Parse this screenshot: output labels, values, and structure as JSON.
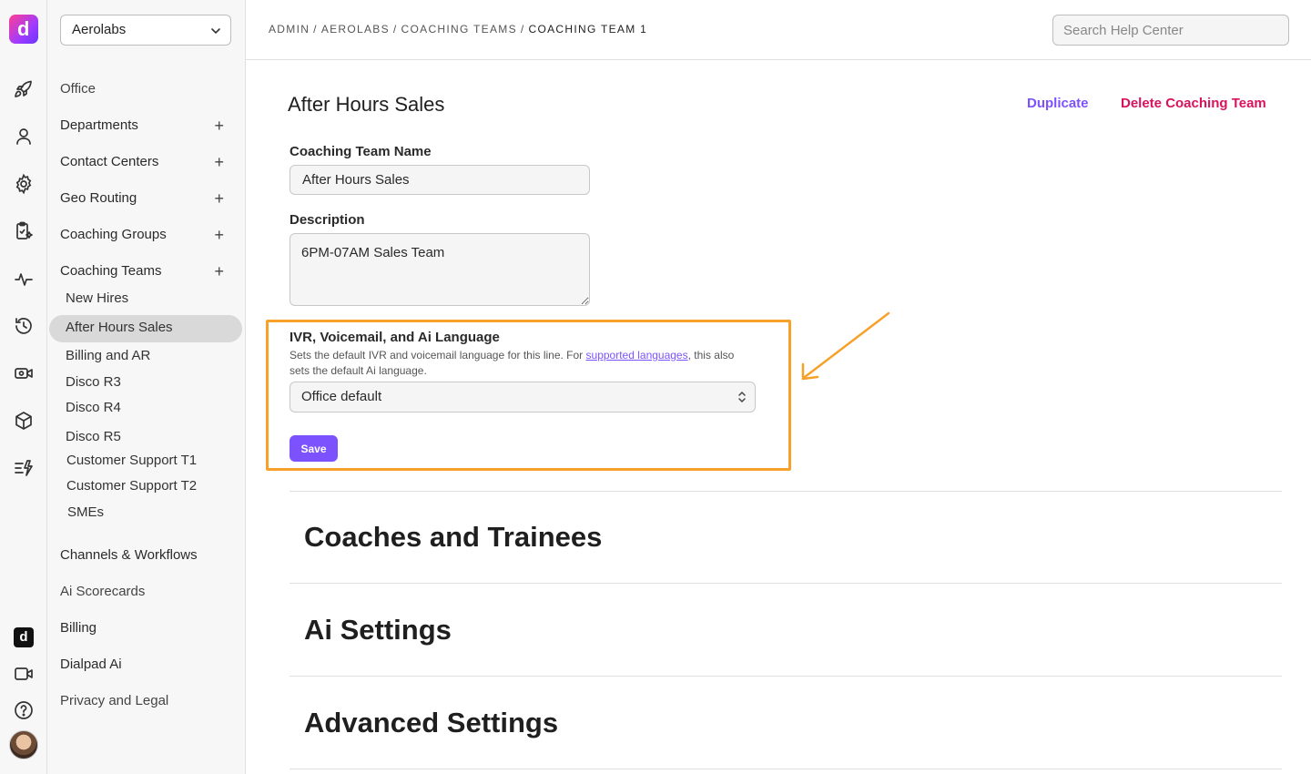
{
  "app": {
    "logo_letter": "d",
    "rail_logo_letter": "d"
  },
  "rail": {
    "icons": [
      "rocket-icon",
      "person-icon",
      "gear-icon",
      "clipboard-sparkle-icon",
      "activity-icon",
      "history-icon",
      "video-gear-icon",
      "cube-icon",
      "workflow-icon",
      "dialpad-app-icon",
      "video-icon",
      "help-icon"
    ]
  },
  "sidebar": {
    "org_selected": "Aerolabs",
    "items": {
      "office": "Office",
      "departments": "Departments",
      "contact_centers": "Contact Centers",
      "geo_routing": "Geo Routing",
      "coaching_groups": "Coaching Groups",
      "coaching_teams": "Coaching Teams",
      "channels_workflows": "Channels & Workflows",
      "ai_scorecards": "Ai Scorecards",
      "billing": "Billing",
      "dialpad_ai": "Dialpad Ai",
      "privacy_legal": "Privacy and Legal"
    },
    "plus_symbol": "+",
    "coaching_teams_children": [
      "New Hires",
      "After Hours Sales",
      "Billing and AR",
      "Disco R3",
      "Disco R4",
      "Disco R5",
      "Customer Support T1",
      "Customer Support T2",
      "SMEs"
    ]
  },
  "topbar": {
    "breadcrumb": [
      "ADMIN",
      "AEROLABS",
      "COACHING TEAMS",
      "COACHING TEAM 1"
    ],
    "separator": "/",
    "search_placeholder": "Search Help Center"
  },
  "main": {
    "title": "After Hours Sales",
    "duplicate_label": "Duplicate",
    "delete_label": "Delete Coaching Team",
    "name_label": "Coaching Team Name",
    "name_value": "After Hours Sales",
    "description_label": "Description",
    "description_value": "6PM-07AM Sales Team",
    "language": {
      "title": "IVR, Voicemail, and Ai Language",
      "desc_before": "Sets the default IVR and voicemail language for this line. For ",
      "desc_link": "supported languages",
      "desc_after": ", this also sets the default Ai language.",
      "selected": "Office default"
    },
    "save_label": "Save",
    "sections": [
      "Coaches and Trainees",
      "Ai Settings",
      "Advanced Settings"
    ]
  },
  "colors": {
    "accent": "#7c52ff",
    "danger": "#d8125b",
    "highlight": "#f7a12a"
  }
}
